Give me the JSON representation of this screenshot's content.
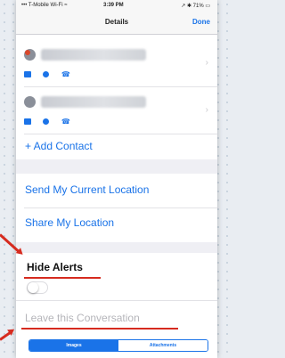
{
  "status_bar": {
    "carrier": "••• T-Mobile Wi-Fi ≈",
    "time": "3:39 PM",
    "battery": "↗ ✱ 71% ▭"
  },
  "nav": {
    "title": "Details",
    "done_label": "Done"
  },
  "contacts": [
    {
      "avatar": "contact-avatar",
      "actions": [
        "video-icon",
        "message-icon",
        "phone-icon"
      ]
    },
    {
      "avatar": "contact-avatar",
      "actions": [
        "video-icon",
        "message-icon",
        "phone-icon"
      ]
    }
  ],
  "add_contact_label": "+ Add Contact",
  "send_location_label": "Send My Current Location",
  "share_location_label": "Share My Location",
  "hide_alerts_label": "Hide Alerts",
  "hide_alerts_toggle": "off",
  "leave_label": "Leave this Conversation",
  "segments": {
    "images_label": "Images",
    "attachments_label": "Attachments"
  },
  "colors": {
    "accent": "#1a73e8",
    "annotation": "#d62b1f"
  },
  "chevron_glyph": "›",
  "phone_glyph": "☎"
}
